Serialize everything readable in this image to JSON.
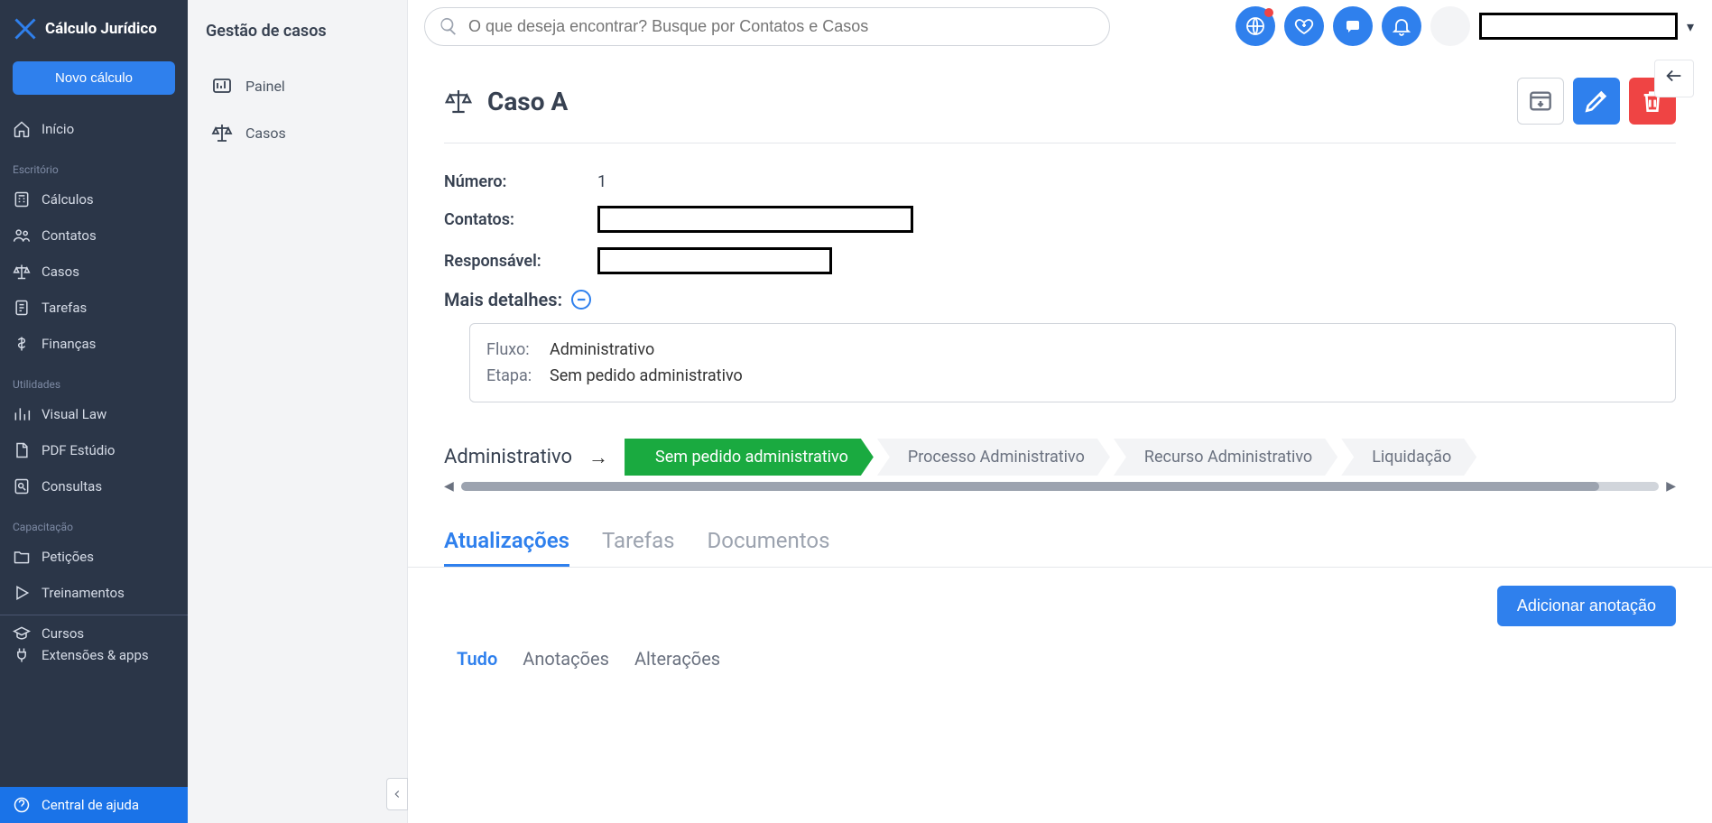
{
  "app": {
    "name": "Cálculo Jurídico"
  },
  "header": {
    "new_button": "Novo cálculo",
    "search_placeholder": "O que deseja encontrar? Busque por Contatos e Casos"
  },
  "sidebar": {
    "items_top": [
      {
        "label": "Início",
        "icon": "home-icon"
      }
    ],
    "groups": [
      {
        "label": "Escritório",
        "items": [
          {
            "label": "Cálculos",
            "icon": "calculator-icon"
          },
          {
            "label": "Contatos",
            "icon": "contacts-icon"
          },
          {
            "label": "Casos",
            "icon": "scales-icon"
          },
          {
            "label": "Tarefas",
            "icon": "tasks-icon"
          },
          {
            "label": "Finanças",
            "icon": "money-icon"
          }
        ]
      },
      {
        "label": "Utilidades",
        "items": [
          {
            "label": "Visual Law",
            "icon": "chart-icon"
          },
          {
            "label": "PDF Estúdio",
            "icon": "pdf-icon"
          },
          {
            "label": "Consultas",
            "icon": "search-file-icon"
          }
        ]
      },
      {
        "label": "Capacitação",
        "items": [
          {
            "label": "Petições",
            "icon": "folder-icon"
          },
          {
            "label": "Treinamentos",
            "icon": "play-icon"
          },
          {
            "label": "Cursos",
            "icon": "grad-cap-icon"
          },
          {
            "label": "Extensões & apps",
            "icon": "plug-icon"
          }
        ]
      }
    ],
    "help": "Central de ajuda"
  },
  "subpanel": {
    "title": "Gestão de casos",
    "items": [
      {
        "label": "Painel",
        "icon": "panel-icon"
      },
      {
        "label": "Casos",
        "icon": "scales-icon"
      }
    ]
  },
  "case": {
    "title": "Caso A",
    "fields": {
      "numero_label": "Número:",
      "numero_value": "1",
      "contatos_label": "Contatos:",
      "responsavel_label": "Responsável:",
      "mais_detalhes_label": "Mais detalhes:"
    },
    "details": {
      "fluxo_label": "Fluxo:",
      "fluxo_value": "Administrativo",
      "etapa_label": "Etapa:",
      "etapa_value": "Sem pedido administrativo"
    },
    "flow": {
      "name": "Administrativo",
      "stages": [
        {
          "label": "Sem pedido administrativo",
          "active": true
        },
        {
          "label": "Processo Administrativo",
          "active": false
        },
        {
          "label": "Recurso Administrativo",
          "active": false
        },
        {
          "label": "Liquidação",
          "active": false
        }
      ]
    },
    "tabs": [
      {
        "label": "Atualizações",
        "active": true
      },
      {
        "label": "Tarefas",
        "active": false
      },
      {
        "label": "Documentos",
        "active": false
      }
    ],
    "add_annotation": "Adicionar anotação",
    "subtabs": [
      {
        "label": "Tudo",
        "active": true
      },
      {
        "label": "Anotações",
        "active": false
      },
      {
        "label": "Alterações",
        "active": false
      }
    ]
  }
}
